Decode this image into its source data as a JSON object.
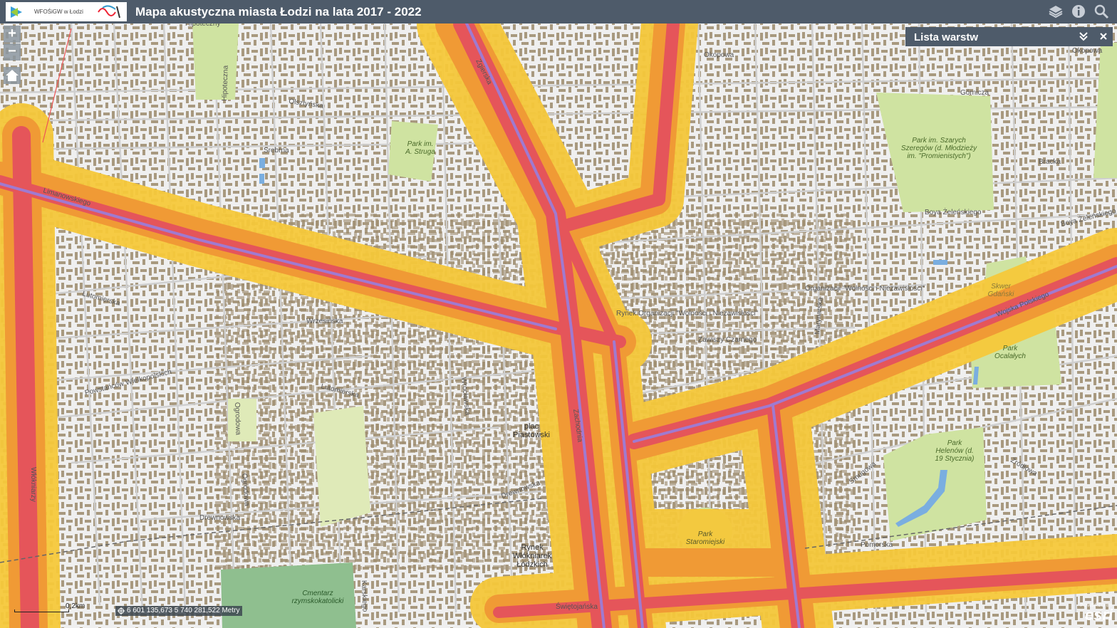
{
  "app": {
    "title": "Mapa akustyczna miasta Łodzi na lata 2017 - 2022",
    "logo_text": "WFOŚiGW w Łodzi"
  },
  "toolbar": {
    "icons": [
      "layers-icon",
      "info-icon",
      "search-icon"
    ]
  },
  "zoom": {
    "in_label": "+",
    "out_label": "−"
  },
  "layer_list": {
    "title": "Lista warstw",
    "collapse_icon": "double-chevron-down-icon",
    "close_label": "×"
  },
  "scale": {
    "label": "0,2km"
  },
  "coordinates": {
    "text": "6 601 135,673 5 740 281,522 Metry"
  },
  "attribution": {
    "powered_by": "POWERED BY",
    "brand": "esri"
  },
  "colors": {
    "topbar": "#4e5b6a",
    "noise_yellow": "#f5c83a",
    "noise_orange": "#f09a35",
    "noise_red": "#e5555a",
    "road_purple": "#a07ad0",
    "park_green": "#cfe3a1",
    "cemetery_green": "#8fbf8f",
    "building": "#9c8a6b",
    "water": "#7aaee0"
  },
  "map_labels": {
    "park_struga": "Park im.\nA. Struga",
    "park_szarych": "Park im. Szarych\nSzeregów (d. Młodzieży\nim. \"Promienistych\")",
    "park_ocalalych": "Park\nOcalałych",
    "skwer_gdanski": "Skwer\nGdański",
    "park_helenow": "Park\nHelenów (d.\n19 Stycznia)",
    "park_staromiejski": "Park\nStaromiejski",
    "plac_piastowski": "plac\nPiastowski",
    "rynek": "Rynek\nWłókniarek\nŁódzkich",
    "cmentarz": "Cmentarz\nrzymskokatolicki",
    "street_limanowskiego": "Limanowskiego",
    "street_zgierska": "Zgierska",
    "street_zachodnia": "Zachodnia",
    "street_wojska": "Wojska Polskiego",
    "street_lutomierska": "Lutomierska",
    "street_lutomierska2": "Lutomierska",
    "street_wroclawska": "Wrocławska",
    "street_drewnowska": "Drewnowska",
    "street_drewnowska2": "Drewnowska",
    "street_gornicza": "Górnicza",
    "street_okopowa": "Okopowa",
    "street_okopowa2": "Okopowa",
    "street_srebrna": "Srebrna",
    "street_olsztynska": "Olsztyńska",
    "street_bracka": "Bracka",
    "street_boya": "Boya Żeleńskiego",
    "street_boya2": "Boya Żeleńskiego",
    "street_smugowa": "Smugowa",
    "street_zrodlowa": "Źródłowa",
    "street_wspolna": "Wspólna",
    "street_powstancow": "Powstańców Wielkopolskich",
    "street_wrzesinska": "Wrzesińska",
    "street_organizacji": "Organizacji \"Wolności i Niezawisłości\"",
    "street_zawiszy": "Zawiszy Czarnego",
    "street_maryn": "Marynarska",
    "street_wlokniarzy": "Włókniarzy",
    "street_hipoteczna": "Hipoteczna",
    "street_rynek_org": "Rynek Organizacji \"Wolności i Niezawisłości\"",
    "street_pomorska": "Pomorska",
    "street_lotnicza": "Łotnicza",
    "street_ogrodowa": "Ogrodowa",
    "street_ogrodowa2": "Ogrodowa",
    "street_swietojanska": "Świętojańska",
    "street_karskiego": "Karskiego",
    "street_biegunowa": "Biegunowa",
    "street_hipoteczny": "Hipoteczny"
  }
}
